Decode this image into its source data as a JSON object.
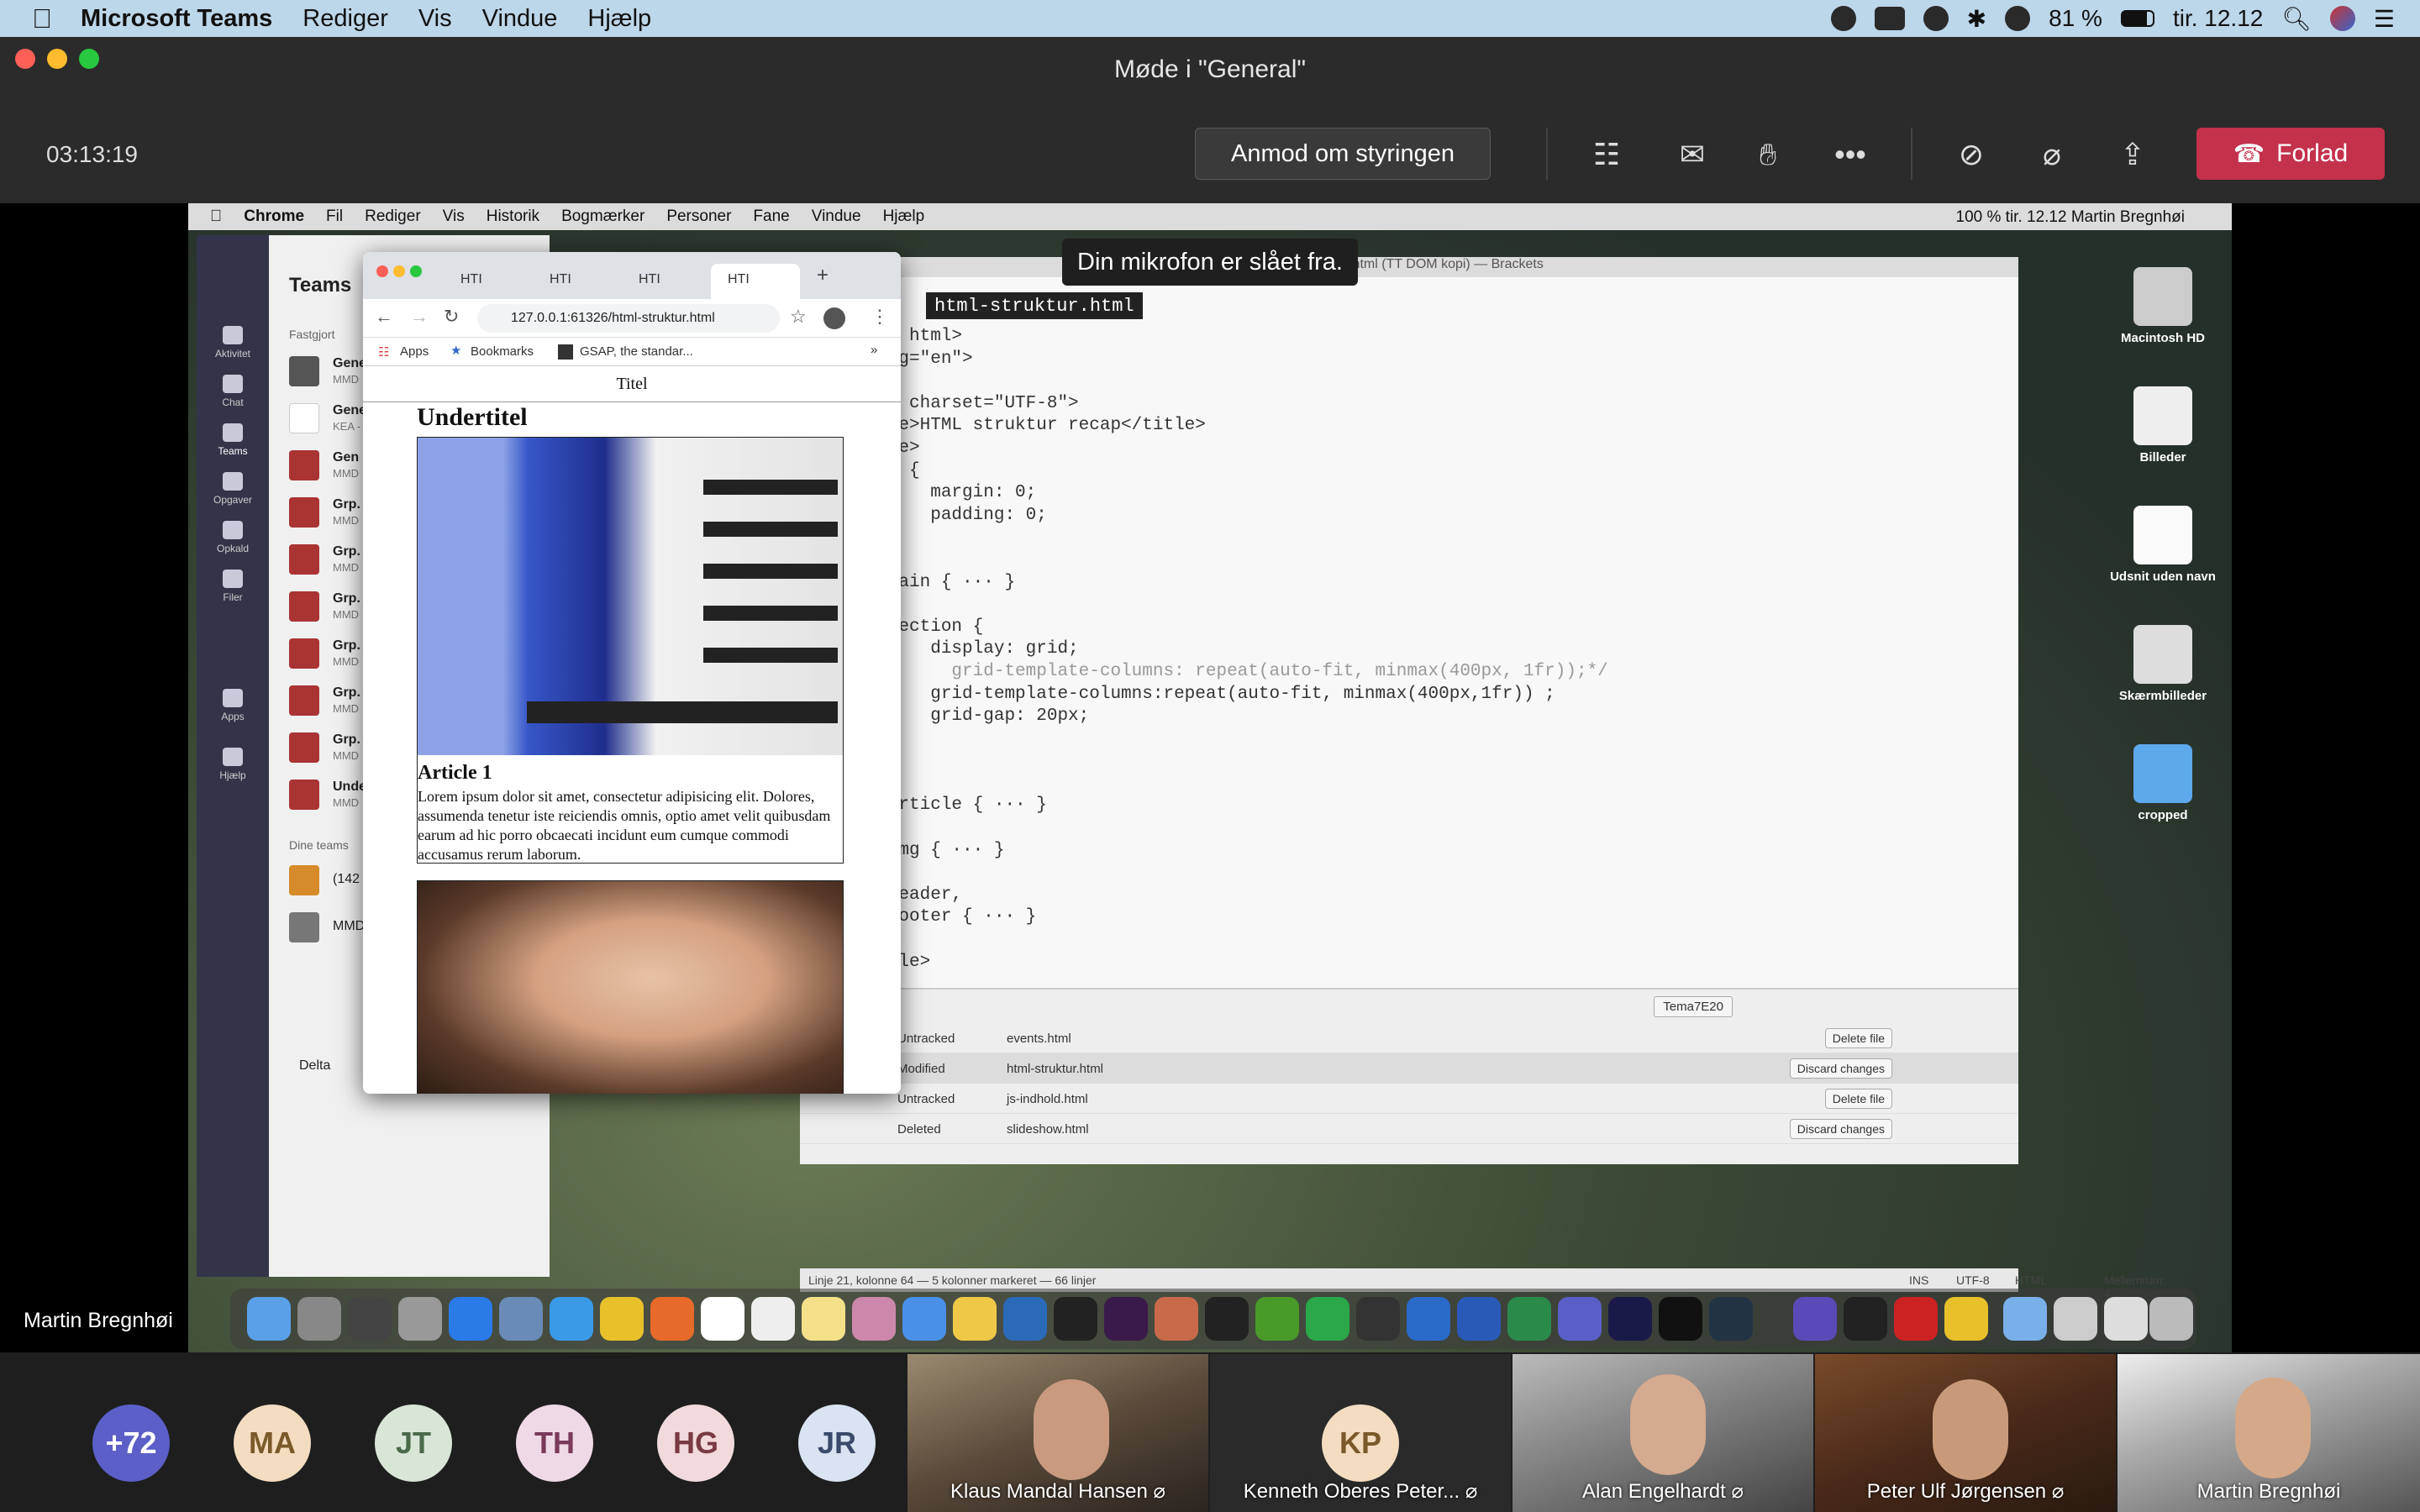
{
  "menubar": {
    "app_name": "Microsoft Teams",
    "items": [
      "Rediger",
      "Vis",
      "Vindue",
      "Hjælp"
    ],
    "battery": "81 %",
    "clock": "tir. 12.12"
  },
  "window": {
    "title": "Møde i \"General\""
  },
  "meeting": {
    "timer": "03:13:19",
    "request_control_label": "Anmod om styringen",
    "leave_label": "Forlad",
    "mic_toast": "Din mikrofon er slået fra.",
    "presenter_name": "Martin Bregnhøi"
  },
  "shared": {
    "mac_menu": [
      "Chrome",
      "Fil",
      "Rediger",
      "Vis",
      "Historik",
      "Bogmærker",
      "Personer",
      "Fane",
      "Vindue",
      "Hjælp"
    ],
    "mac_menu_right": "100 %   tir. 12.12   Martin Bregnhøi",
    "teams": {
      "title": "Teams",
      "pinned_label": "Fastgjort",
      "your_teams_label": "Dine teams",
      "rail": [
        "Aktivitet",
        "Chat",
        "Teams",
        "Opgaver",
        "Opkald",
        "Filer",
        "Apps",
        "Hjælp"
      ],
      "channels": [
        {
          "t": "Gene",
          "s": "MMD"
        },
        {
          "t": "Gene",
          "s": "KEA -"
        },
        {
          "t": "Gen",
          "s": "MMD"
        },
        {
          "t": "Grp.",
          "s": "MMD"
        },
        {
          "t": "Grp.",
          "s": "MMD"
        },
        {
          "t": "Grp.",
          "s": "MMD"
        },
        {
          "t": "Grp.",
          "s": "MMD"
        },
        {
          "t": "Grp.",
          "s": "MMD"
        },
        {
          "t": "Grp.",
          "s": "MMD"
        },
        {
          "t": "Unde",
          "s": "MMD"
        }
      ],
      "teams_list": [
        {
          "t": "(142"
        },
        {
          "t": "MMD"
        }
      ],
      "bottom": "Delta"
    },
    "chrome": {
      "tabs": [
        "HTI",
        "HTI",
        "HTI",
        "HTI"
      ],
      "url": "127.0.0.1:61326/html-struktur.html",
      "bookmarks": [
        "Apps",
        "Bookmarks",
        "GSAP, the standar..."
      ],
      "page": {
        "title": "Titel",
        "subtitle": "Undertitel",
        "article1_heading": "Article 1",
        "article1_text": "Lorem ipsum dolor sit amet, consectetur adipisicing elit. Dolores, assumenda tenetur iste reiciendis omnis, optio amet velit quibusdam earum ad hic porro obcaecati incidunt eum cumque commodi accusamus rerum laborum."
      }
    },
    "brackets": {
      "window_title": "html-struktur.html (TT DOM kopi) — Brackets",
      "tab": "html-struktur.html",
      "code_lines": [
        "<!DOCTYPE html>",
        "<html lang=\"en\">",
        "<head>",
        "    <meta charset=\"UTF-8\">",
        "    <title>HTML struktur recap</title>",
        "    <style>",
        "        * {",
        "            margin: 0;",
        "            padding: 0;",
        "        }",
        "",
        "        main { ··· }",
        "",
        "        section {",
        "            display: grid;",
        "/*            grid-template-columns: repeat(auto-fit, minmax(400px, 1fr));*/",
        "            grid-template-columns:repeat(auto-fit, minmax(400px,1fr)) ;",
        "            grid-gap: 20px;",
        "",
        "        }",
        "",
        "        article { ··· }",
        "",
        "        img { ··· }",
        "",
        "        header,",
        "        footer { ··· }",
        "",
        "    </style>",
        "</head>"
      ],
      "git": {
        "branch": "Tema7E20",
        "rows": [
          {
            "status": "Untracked",
            "file": "events.html",
            "action": "Delete file"
          },
          {
            "status": "Modified",
            "file": "html-struktur.html",
            "action": "Discard changes"
          },
          {
            "status": "Untracked",
            "file": "js-indhold.html",
            "action": "Delete file"
          },
          {
            "status": "Deleted",
            "file": "slideshow.html",
            "action": "Discard changes"
          }
        ]
      },
      "status_bar": "Linje 21, kolonne 64 — 5 kolonner markeret — 66 linjer",
      "status_right": [
        "INS",
        "UTF-8",
        "HTML",
        "Mellemrum: 4"
      ]
    },
    "desktop_items": [
      "Macintosh HD",
      "Billeder",
      "Udsnit uden navn",
      "Skærmbilleder",
      "cropped"
    ]
  },
  "gallery": {
    "avatars": [
      {
        "initials": "+72",
        "color": "#5b5fc7",
        "text": "#ffffff"
      },
      {
        "initials": "MA",
        "color": "#f3dcc0",
        "text": "#7a5a2a"
      },
      {
        "initials": "JT",
        "color": "#d9e6d7",
        "text": "#4a6a4a"
      },
      {
        "initials": "TH",
        "color": "#efd9e6",
        "text": "#7a3a5a"
      },
      {
        "initials": "HG",
        "color": "#f1d9dc",
        "text": "#7a3a44"
      },
      {
        "initials": "JR",
        "color": "#d9e3f1",
        "text": "#3a4a6a"
      }
    ],
    "videos": [
      "Klaus Mandal Hansen",
      "Kenneth Oberes Peter...",
      "Alan Engelhardt",
      "Peter Ulf Jørgensen",
      "Martin Bregnhøi"
    ],
    "kp_initials": "KP"
  },
  "colors": {
    "leave": "#c4314b",
    "teams_purple": "#5b5fc7"
  }
}
